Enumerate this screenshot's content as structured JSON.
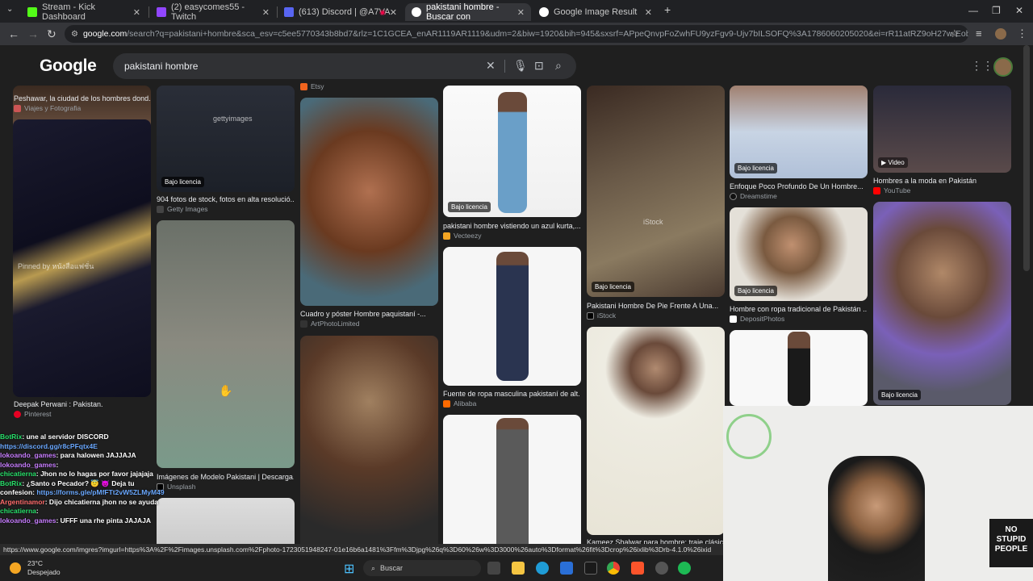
{
  "tabs": [
    {
      "label": "Stream - Kick Dashboard",
      "favicon_color": "#53fc18"
    },
    {
      "label": "(2) easycomes55 - Twitch",
      "favicon_color": "#9146ff"
    },
    {
      "label": "(613) Discord | @A7VA",
      "favicon_color": "#5865f2"
    },
    {
      "label": "pakistani hombre - Buscar con",
      "favicon_color": "#4285f4"
    },
    {
      "label": "Google Image Result",
      "favicon_color": "#4285f4"
    }
  ],
  "address_bar": {
    "host": "google.com",
    "rest": "/search?q=pakistani+hombre&sca_esv=c5ee5770343b8bd7&rlz=1C1GCEA_enAR1119AR1119&udm=2&biw=1920&bih=945&sxsrf=APpeQnvpFoZwhFU9yzFgv9-Ujv7bILSOFQ%3A1786060205020&ei=rR11atRZ9oH27w-EobHIDQ&oq=pakistani&..."
  },
  "google": {
    "logo": "Google",
    "query": "pakistani hombre"
  },
  "results": {
    "col1": [
      {
        "caption": "Peshawar, la ciudad de los hombres dond...",
        "source": "Viajes y Fotografia"
      },
      {
        "caption": "Deepak Perwani : Pakistan.",
        "source": "Pinterest",
        "overlay": "Pinned by หนังสือแฟชั่น"
      }
    ],
    "col2": [
      {
        "caption": "904 fotos de stock, fotos en alta resolució...",
        "source": "Getty Images",
        "license": "Bajo licencia",
        "watermark": "gettyimages"
      },
      {
        "caption": "Imágenes de Modelo Pakistani | Descarga...",
        "source": "Unsplash"
      }
    ],
    "col3": [
      {
        "source_top": "Etsy"
      },
      {
        "caption": "Cuadro y póster Hombre paquistaní -...",
        "source": "ArtPhotoLimited"
      }
    ],
    "col4": [
      {
        "caption": "pakistani hombre vistiendo un azul kurta,...",
        "source": "Vecteezy",
        "license": "Bajo licencia"
      },
      {
        "caption": "Fuente de ropa masculina pakistaní de alt...",
        "source": "Alibaba"
      }
    ],
    "col5": [
      {
        "caption": "Pakistani Hombre De Pie Frente A Una...",
        "source": "iStock",
        "license": "Bajo licencia",
        "watermark": "iStock"
      },
      {
        "caption": "Kameez Shalwar para hombre: traje clásic..."
      }
    ],
    "col6": [
      {
        "caption": "Enfoque Poco Profundo De Un Hombre...",
        "source": "Dreamstime",
        "license": "Bajo licencia"
      },
      {
        "caption": "Hombre con ropa tradicional de Pakistán ...",
        "source": "DepositPhotos",
        "license": "Bajo licencia"
      }
    ],
    "col7": [
      {
        "caption": "Hombres a la moda en Pakistán",
        "source": "YouTube",
        "video": "Video"
      },
      {
        "license": "Bajo licencia"
      }
    ]
  },
  "chat": [
    {
      "user": "BotRix",
      "msg": ": une al servidor DISCORD",
      "cls": "u1"
    },
    {
      "user": "",
      "msg": "https://discord.gg/r8cPFqtx4E",
      "cls": "lnk"
    },
    {
      "user": "lokoando_games",
      "msg": ": para halowen JAJJAJA",
      "cls": "u2"
    },
    {
      "user": "lokoando_games",
      "msg": ":",
      "cls": "u2"
    },
    {
      "user": "chicatierna",
      "msg": ": Jhon no lo hagas por favor jajajaja",
      "cls": "u1"
    },
    {
      "user": "BotRix",
      "msg": ": ¿Santo o Pecador? 😇 😈 Deja tu",
      "cls": "u1"
    },
    {
      "user": "confesion:",
      "msg": " https://forms.gle/pMfFTt2vW5ZLMyM49",
      "cls": "lnk"
    },
    {
      "user": "Argentinamor",
      "msg": ": Dijo chicatierna jhon no se ayuda",
      "cls": "u3"
    },
    {
      "user": "chicatierna",
      "msg": ":",
      "cls": "u1"
    },
    {
      "user": "lokoando_games",
      "msg": ": UFFF una rhe pinta JAJAJA",
      "cls": "u2"
    }
  ],
  "statusbar_url": "https://www.google.com/imgres?imgurl=https%3A%2F%2Fimages.unsplash.com%2Fphoto-1723051948247-01e16b6a1481%3Ffm%3Djpg%26q%3D60%26w%3D3000%26auto%3Dformat%26fit%3Dcrop%26ixlib%3Drb-4.1.0%26ixid",
  "taskbar": {
    "temp": "23°C",
    "weather": "Despejado",
    "search": "Buscar"
  },
  "webcam": {
    "sign": "NO STUPID PEOPLE"
  }
}
